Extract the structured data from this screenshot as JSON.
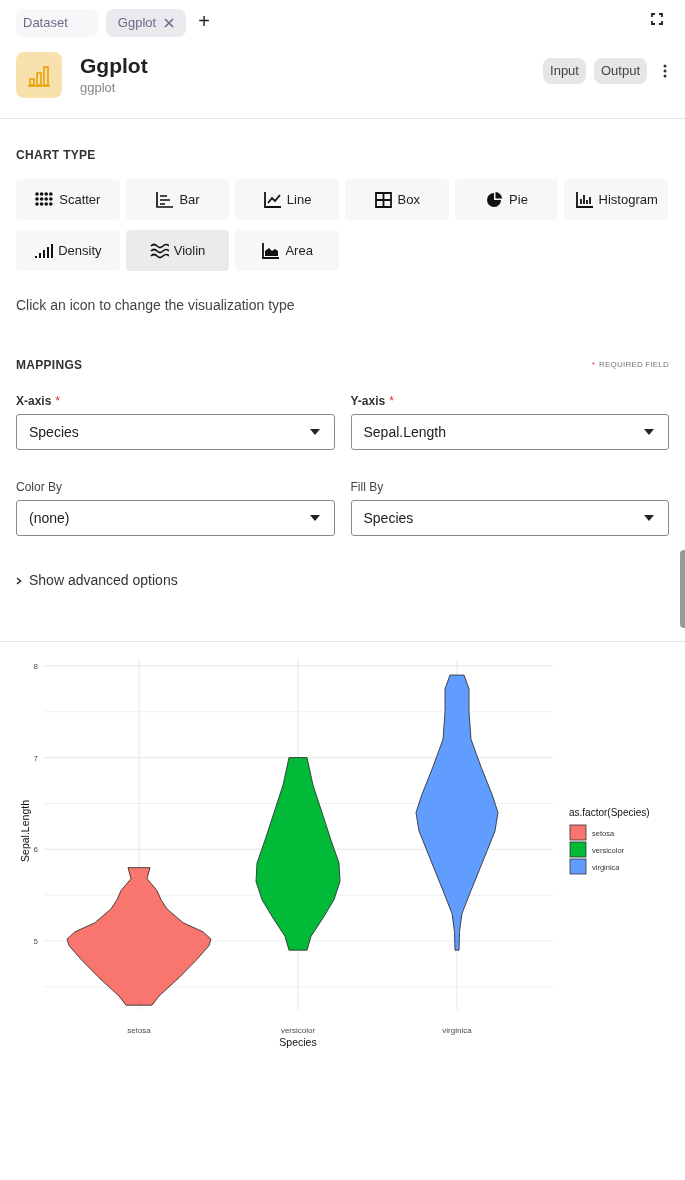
{
  "tabs": [
    {
      "label": "Dataset",
      "selected": false,
      "closable": false
    },
    {
      "label": "Ggplot",
      "selected": true,
      "closable": true
    }
  ],
  "add_tab": "+",
  "header": {
    "title": "Ggplot",
    "subtitle": "ggplot",
    "buttons": [
      "Input",
      "Output"
    ]
  },
  "chart_type": {
    "heading": "CHART TYPE",
    "options": [
      {
        "label": "Scatter",
        "kind": "scatter",
        "selected": false
      },
      {
        "label": "Bar",
        "kind": "bar",
        "selected": false
      },
      {
        "label": "Line",
        "kind": "line",
        "selected": false
      },
      {
        "label": "Box",
        "kind": "box",
        "selected": false
      },
      {
        "label": "Pie",
        "kind": "pie",
        "selected": false
      },
      {
        "label": "Histogram",
        "kind": "histogram",
        "selected": false
      },
      {
        "label": "Density",
        "kind": "density",
        "selected": false
      },
      {
        "label": "Violin",
        "kind": "violin",
        "selected": true
      },
      {
        "label": "Area",
        "kind": "area",
        "selected": false
      }
    ],
    "hint": "Click an icon to change the visualization type"
  },
  "mappings": {
    "heading": "MAPPINGS",
    "required_mark": "*",
    "required_note": "REQUIRED FIELD",
    "fields": [
      {
        "label": "X-axis",
        "required": true,
        "value": "Species"
      },
      {
        "label": "Y-axis",
        "required": true,
        "value": "Sepal.Length"
      },
      {
        "label": "Color By",
        "required": false,
        "value": "(none)"
      },
      {
        "label": "Fill By",
        "required": false,
        "value": "Species"
      }
    ],
    "advanced": "Show advanced options",
    "advanced_expanded": false
  },
  "plot": {
    "ylabel": "Sepal.Length",
    "xlabel": "Species",
    "yticks": [
      "8",
      "7",
      "6",
      "5"
    ],
    "categories": [
      "setosa",
      "versicolor",
      "virginica"
    ],
    "legend": {
      "title": "as.factor(Species)",
      "items": [
        {
          "label": "setosa",
          "color": "#f8766d"
        },
        {
          "label": "versicolor",
          "color": "#00ba38"
        },
        {
          "label": "virginica",
          "color": "#619cff"
        }
      ]
    }
  }
}
